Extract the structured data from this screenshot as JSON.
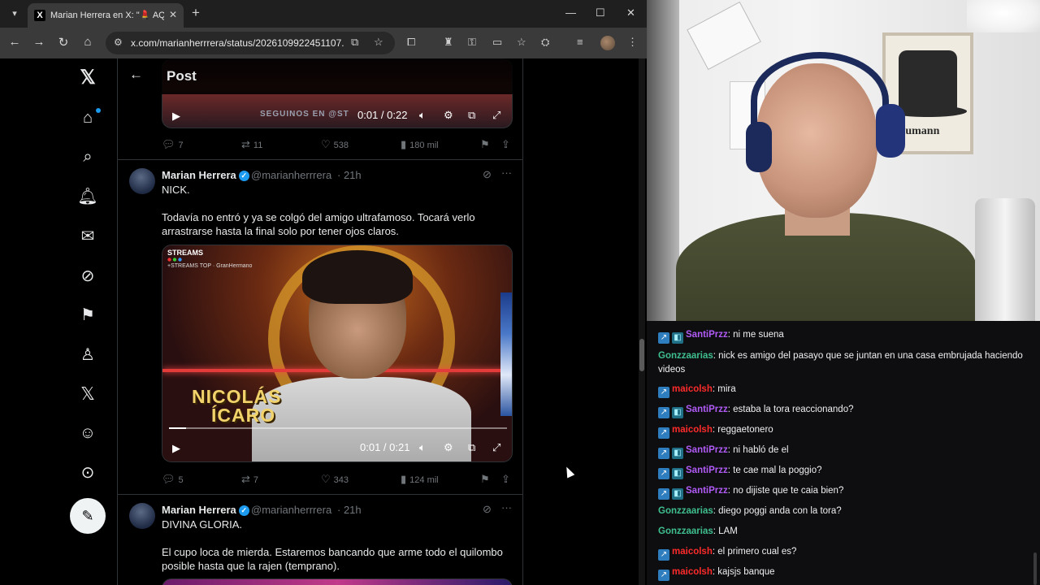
{
  "browser": {
    "tab_title": "Marian Herrera en X: \"💄 AQUÍ",
    "tab_favicon": "X",
    "url": "x.com/marianherrrera/status/2026109922451107...",
    "icons": [
      "tab-search-icon",
      "close-icon",
      "new-tab-icon",
      "minimize-icon",
      "maximize-icon",
      "window-close-icon",
      "back-icon",
      "forward-icon",
      "reload-icon",
      "home-icon",
      "site-info-icon",
      "install-icon",
      "star-icon",
      "extension-icons",
      "profile-avatar"
    ]
  },
  "x": {
    "header_title": "Post",
    "nav_icons": [
      "x-logo-icon",
      "home-icon",
      "search-icon",
      "notifications-icon",
      "messages-icon",
      "grok-icon",
      "bookmarks-icon",
      "premium-icon",
      "x-icon",
      "profile-icon",
      "more-icon",
      "post-compose-icon"
    ],
    "top_video": {
      "overlay_text": "SEGUINOS EN @ST",
      "time": "0:01 / 0:22"
    },
    "top_actions": {
      "replies": "7",
      "reposts": "11",
      "likes": "538",
      "views": "180 mil"
    },
    "tweets": [
      {
        "name": "Marian Herrera",
        "handle": "@marianherrrera",
        "time": "· 21h",
        "line1": "NICK.",
        "line2": "Todavía no entró y ya se colgó del amigo ultrafamoso. Tocará verlo arrastrarse hasta la final solo por tener ojos claros.",
        "video": {
          "badge": "STREAMS",
          "badge_sub": "+STREAMS TOP · GranHermano",
          "name_line1": "NICOLÁS",
          "name_line2": "ÍCARO",
          "time": "0:01 / 0:21",
          "progress": 0.05
        },
        "actions": {
          "replies": "5",
          "reposts": "7",
          "likes": "343",
          "views": "124 mil"
        }
      },
      {
        "name": "Marian Herrera",
        "handle": "@marianherrrera",
        "time": "· 21h",
        "line1": "DIVINA GLORIA.",
        "line2": "El cupo loca de mierda. Estaremos bancando que arme todo el quilombo posible hasta que la rajen (temprano)."
      }
    ]
  },
  "webcam": {
    "poster_text": "Baumann"
  },
  "chat": {
    "colors": {
      "SantiPrzz": "#b05bf5",
      "Gonzzaarias": "#3fbf8f",
      "maicolsh": "#ff2b2b"
    },
    "messages": [
      {
        "user": "SantiPrzz",
        "badges": 2,
        "text": "ni me suena"
      },
      {
        "user": "Gonzzaarias",
        "badges": 0,
        "text": "nick es amigo del pasayo que se juntan en una casa embrujada haciendo videos"
      },
      {
        "user": "maicolsh",
        "badges": 1,
        "text": "mira"
      },
      {
        "user": "SantiPrzz",
        "badges": 2,
        "text": "estaba la tora reaccionando?"
      },
      {
        "user": "maicolsh",
        "badges": 1,
        "text": "reggaetonero"
      },
      {
        "user": "SantiPrzz",
        "badges": 2,
        "text": "ni habló de el"
      },
      {
        "user": "SantiPrzz",
        "badges": 2,
        "text": "te cae mal la poggio?"
      },
      {
        "user": "SantiPrzz",
        "badges": 2,
        "text": "no dijiste que te caia bien?"
      },
      {
        "user": "Gonzzaarias",
        "badges": 0,
        "text": "diego poggi anda con la tora?"
      },
      {
        "user": "Gonzzaarias",
        "badges": 0,
        "text": "LAM"
      },
      {
        "user": "maicolsh",
        "badges": 1,
        "text": "el primero cual es?"
      },
      {
        "user": "maicolsh",
        "badges": 1,
        "text": "kajsjs banque"
      }
    ]
  }
}
